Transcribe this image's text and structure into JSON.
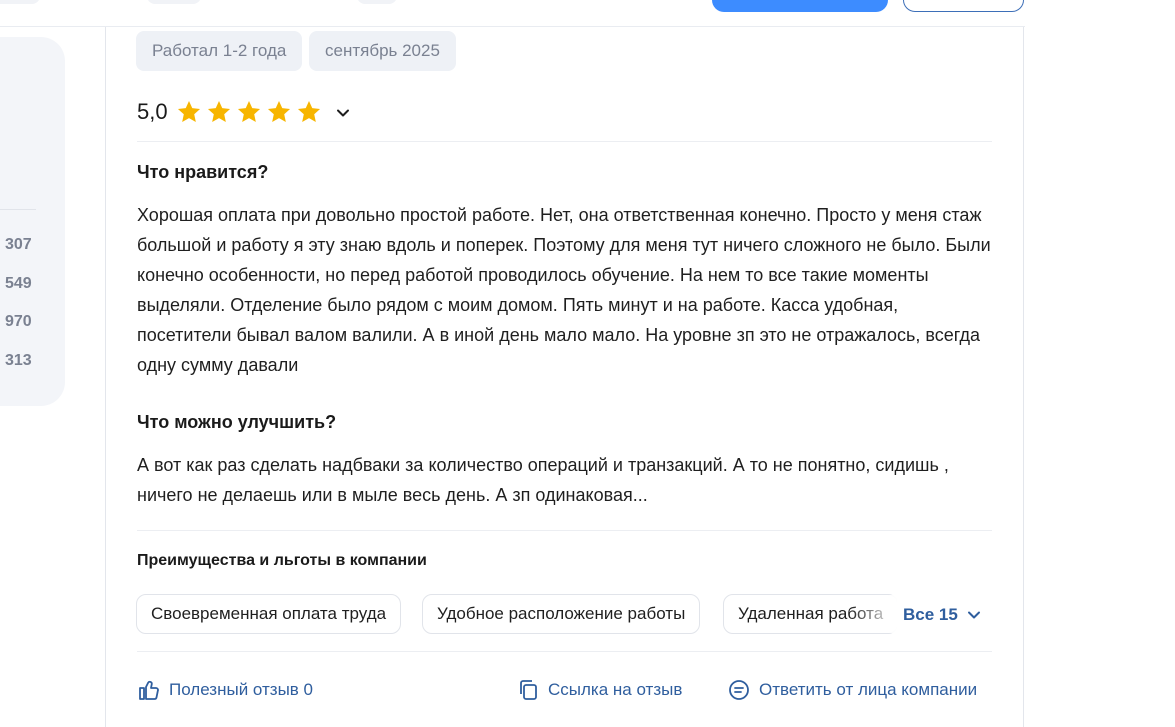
{
  "tags": [
    "Работал 1-2 года",
    "сентябрь 2025"
  ],
  "rating": {
    "value": "5,0",
    "stars": 5,
    "max": 5,
    "star_color": "#f7b500"
  },
  "sections": [
    {
      "title": "Что нравится?",
      "text": "Хорошая оплата при довольно простой работе. Нет, она ответственная конечно. Просто у меня стаж большой и работу я эту знаю вдоль и поперек. Поэтому для меня тут ничего сложного не было. Были конечно особенности, но перед работой проводилось обучение. На нем то все такие моменты выделяли. Отделение было рядом с моим домом. Пять минут и на работе. Касса удобная, посетители бывал валом валили. А в иной день мало мало. На уровне зп это не отражалось, всегда одну сумму давали"
    },
    {
      "title": "Что можно улучшить?",
      "text": "А вот как раз сделать надбваки за количество операций и транзакций. А то не понятно, сидишь , ничего не делаешь или в мыле весь день. А зп одинаковая..."
    }
  ],
  "benefits": {
    "title": "Преимущества и льготы в компании",
    "items": [
      "Своевременная оплата труда",
      "Удобное расположение работы",
      "Удаленная работа"
    ],
    "all_label": "Все 15"
  },
  "actions": {
    "helpful": "Полезный отзыв 0",
    "link": "Ссылка на отзыв",
    "reply": "Ответить от лица компании"
  },
  "sidebar": {
    "counts": [
      "307",
      "549",
      "970",
      "313"
    ]
  },
  "colors": {
    "accent": "#2f5e9e",
    "primary_button": "#3d8cff",
    "tag_bg": "#eef1f6"
  }
}
